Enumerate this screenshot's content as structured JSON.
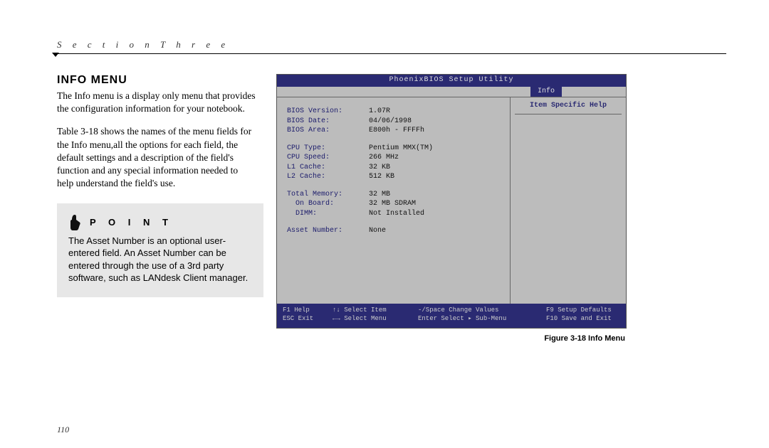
{
  "section_header": "S e c t i o n   T h r e e",
  "heading": "Info Menu",
  "para1": "The Info menu is a display only menu that provides the configuration information for your notebook.",
  "para2": "Table 3-18 shows the names of the menu fields for the Info menu,all the options for each field, the default settings and a description of the field's function and any special information needed to help understand the field's use.",
  "point": {
    "label": "P O I N T",
    "text": "The Asset Number is an optional user-entered field. An Asset Number can be entered through the use of a 3rd party software, such as LANdesk Client manager."
  },
  "bios": {
    "title": "PhoenixBIOS Setup Utility",
    "tab": "Info",
    "help_header": "Item Specific Help",
    "rows": {
      "g1": [
        {
          "k": "BIOS Version:",
          "v": "1.07R"
        },
        {
          "k": "BIOS Date:",
          "v": "04/06/1998"
        },
        {
          "k": "BIOS Area:",
          "v": "E800h - FFFFh"
        }
      ],
      "g2": [
        {
          "k": "CPU Type:",
          "v": "Pentium MMX(TM)"
        },
        {
          "k": "CPU Speed:",
          "v": "266 MHz"
        },
        {
          "k": "L1 Cache:",
          "v": "32 KB"
        },
        {
          "k": "L2 Cache:",
          "v": "512 KB"
        }
      ],
      "g3": [
        {
          "k": "Total Memory:",
          "v": "32 MB"
        },
        {
          "k": "On Board:",
          "v": "32 MB SDRAM",
          "indent": true
        },
        {
          "k": "DIMM:",
          "v": "Not Installed",
          "indent": true
        }
      ],
      "g4": [
        {
          "k": "Asset Number:",
          "v": "None"
        }
      ]
    },
    "footer": {
      "r1c1": "F1  Help",
      "r1c2": "↑↓ Select Item",
      "r1c3": "-/Space Change Values",
      "r1c4": "F9 Setup Defaults",
      "r2c1": "ESC Exit",
      "r2c2": "←→ Select Menu",
      "r2c3": "Enter Select ▸ Sub-Menu",
      "r2c4": "F10 Save and Exit"
    }
  },
  "caption": "Figure 3-18 Info Menu",
  "page_number": "110"
}
